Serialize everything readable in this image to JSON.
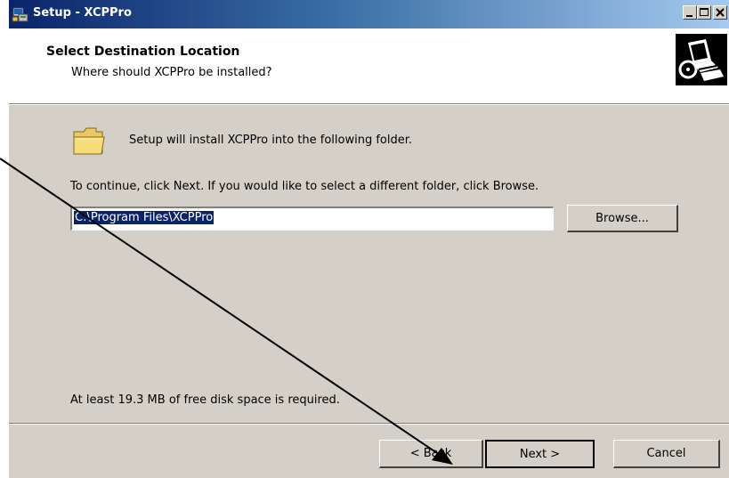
{
  "window": {
    "title": "Setup - XCPPro",
    "app_icon": "setup-installer-icon",
    "controls": [
      "minimize-icon",
      "maximize-icon",
      "close-icon"
    ]
  },
  "header": {
    "title": "Select Destination Location",
    "subtitle": "Where should XCPPro be installed?",
    "icon": "computer-disk-icon"
  },
  "main": {
    "folder_icon": "folder-icon",
    "intro": "Setup will install XCPPro into the following folder.",
    "instruction": "To continue, click Next. If you would like to select a different folder, click Browse.",
    "path_value": "C:\\Program Files\\XCPPro",
    "browse_label": "Browse...",
    "disk_space": "At least 19.3 MB of free disk space is required."
  },
  "footer": {
    "back_label": "< Back",
    "next_label": "Next >",
    "cancel_label": "Cancel"
  },
  "annotation": {
    "type": "arrow",
    "color": "#000000"
  }
}
